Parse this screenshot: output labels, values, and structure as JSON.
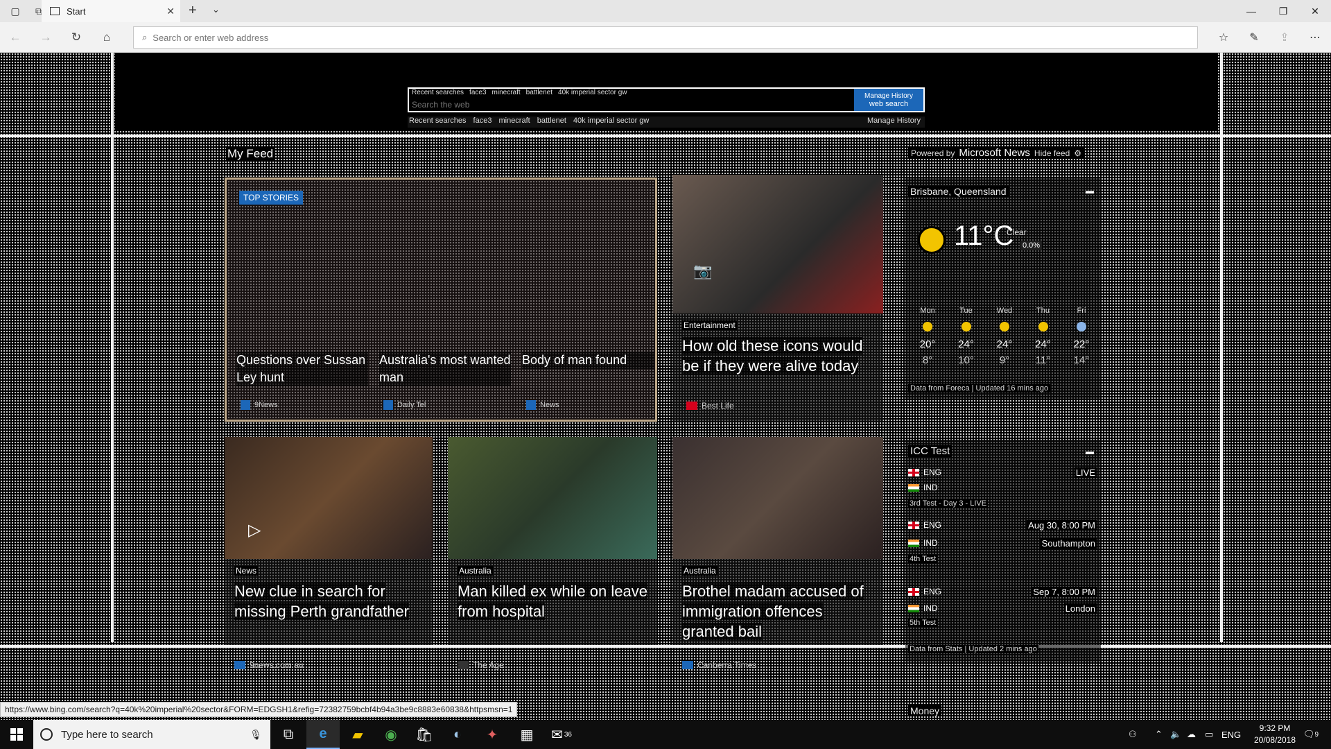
{
  "browser": {
    "tab_title": "Start",
    "address_placeholder": "Search or enter web address"
  },
  "search": {
    "recent_label": "Recent searches",
    "recent": [
      "face3",
      "minecraft",
      "battlenet",
      "40k imperial sector gw"
    ],
    "placeholder": "Search the web",
    "button_label": "web search",
    "manage_history": "Manage History"
  },
  "feed": {
    "title": "My Feed",
    "powered_by": "Powered by",
    "provider": "Microsoft News",
    "hide_feed": "Hide feed",
    "top_stories_label": "TOP STORIES",
    "top_stories": [
      {
        "headline": "Questions over Sussan Ley hunt",
        "source": "9News"
      },
      {
        "headline": "Australia's most wanted man",
        "source": "Daily Tel"
      },
      {
        "headline": "Body of man found",
        "source": "News"
      }
    ],
    "cards": [
      {
        "category": "Entertainment",
        "title": "How old these icons would be if they were alive today",
        "source": "Best Life"
      },
      {
        "category": "News",
        "title": "New clue in search for missing Perth grandfather",
        "source": "9news.com.au"
      },
      {
        "category": "Australia",
        "title": "Man killed ex while on leave from hospital",
        "source": "The Age"
      },
      {
        "category": "Australia",
        "title": "Brothel madam accused of immigration offences granted bail",
        "source": "Canberra Times"
      }
    ]
  },
  "weather": {
    "location": "Brisbane, Queensland",
    "temperature": "11°C",
    "condition": "Clear",
    "precip": "0.0%",
    "days": [
      {
        "name": "Mon",
        "high": "20°",
        "low": "8°"
      },
      {
        "name": "Tue",
        "high": "24°",
        "low": "10°"
      },
      {
        "name": "Wed",
        "high": "24°",
        "low": "9°"
      },
      {
        "name": "Thu",
        "high": "24°",
        "low": "11°"
      },
      {
        "name": "Fri",
        "high": "22°",
        "low": "14°"
      }
    ],
    "footer": "Data from Foreca | Updated 16 mins ago"
  },
  "cricket": {
    "title": "ICC Test",
    "live": "LIVE",
    "match1": {
      "team1": "ENG",
      "team2": "IND",
      "status": "3rd Test - Day 3 - LIVE"
    },
    "match2": {
      "team1": "ENG",
      "team2": "IND",
      "date": "Aug 30, 8:00 PM",
      "venue": "Southampton",
      "label": "4th Test"
    },
    "match3": {
      "team1": "ENG",
      "team2": "IND",
      "date": "Sep 7, 8:00 PM",
      "venue": "London",
      "label": "5th Test"
    },
    "footer": "Data from Stats | Updated 2 mins ago"
  },
  "money": {
    "title": "Money"
  },
  "status_url": "https://www.bing.com/search?q=40k%20imperial%20sector&FORM=EDGSH1&refig=72382759bcbf4b94a3be9c8883e60838&httpsmsn=1",
  "taskbar": {
    "search_placeholder": "Type here to search",
    "mail_badge": "36",
    "language": "ENG",
    "time": "9:32 PM",
    "date": "20/08/2018",
    "notifications": "9"
  }
}
